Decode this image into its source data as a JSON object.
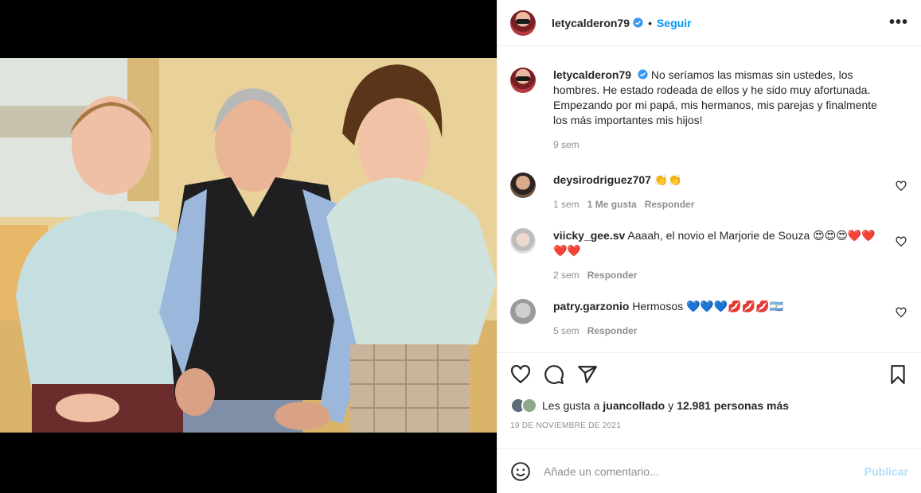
{
  "post": {
    "author": "letycalderon79",
    "follow_label": "Seguir",
    "separator": "•",
    "more_label": "•••",
    "caption": "No seríamos las mismas sin ustedes, los hombres. He estado rodeada de ellos y he sido muy afortunada. Empezando por mi papá, mis hermanos, mis parejas y finalmente los más importantes mis hijos!",
    "caption_time": "9 sem"
  },
  "comments": [
    {
      "user": "deysirodriguez707",
      "text": "👏👏",
      "time": "1 sem",
      "likes": "1 Me gusta",
      "reply": "Responder"
    },
    {
      "user": "viicky_gee.sv",
      "text": "Aaaah, el novio el Marjorie de Souza 😍😍😍❤️❤️❤️❤️",
      "time": "2 sem",
      "reply": "Responder"
    },
    {
      "user": "patry.garzonio",
      "text": "Hermosos 💙💙💙💋💋💋🇦🇷",
      "time": "5 sem",
      "reply": "Responder"
    }
  ],
  "likes": {
    "prefix": "Les gusta a",
    "user": "juancollado",
    "conj": "y",
    "count_text": "12.981 personas más"
  },
  "date": "19 DE NOVIEMBRE DE 2021",
  "add_comment": {
    "placeholder": "Añade un comentario...",
    "publish_label": "Publicar"
  },
  "colors": {
    "accent": "#0095f6",
    "publish_disabled": "#b2dffc",
    "muted": "#8e8e8e"
  }
}
